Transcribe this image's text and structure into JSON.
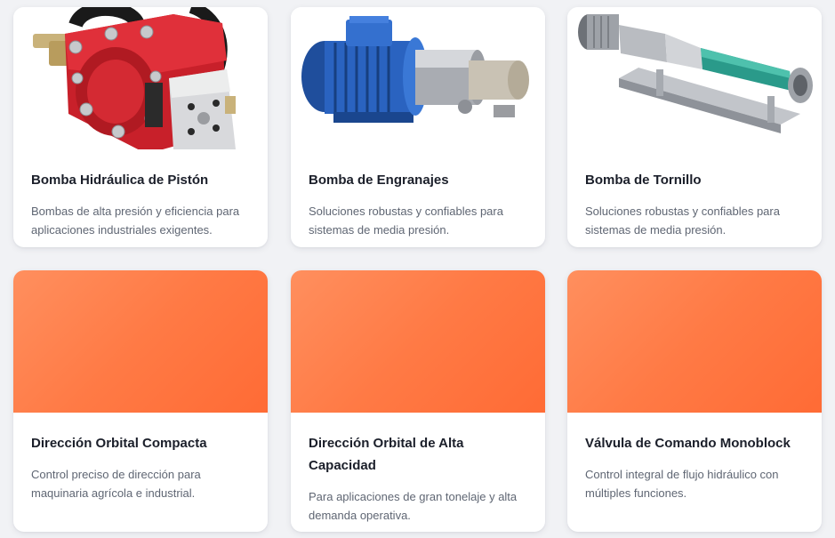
{
  "cards": [
    {
      "title": "Bomba Hidráulica de Pistón",
      "description": "Bombas de alta presión y eficiencia para aplicaciones industriales exigentes.",
      "image": "piston-pump-photo"
    },
    {
      "title": "Bomba de Engranajes",
      "description": "Soluciones robustas y confiables para sistemas de media presión.",
      "image": "gear-pump-photo"
    },
    {
      "title": "Bomba de Tornillo",
      "description": "Soluciones robustas y confiables para sistemas de media presión.",
      "image": "screw-pump-photo"
    },
    {
      "title": "Dirección Orbital Compacta",
      "description": "Control preciso de dirección para maquinaria agrícola e industrial.",
      "image": "orange-gradient-placeholder"
    },
    {
      "title": "Dirección Orbital de Alta Capacidad",
      "description": "Para aplicaciones de gran tonelaje y alta demanda operativa.",
      "image": "orange-gradient-placeholder"
    },
    {
      "title": "Válvula de Comando Monoblock",
      "description": "Control integral de flujo hidráulico con múltiples funciones.",
      "image": "orange-gradient-placeholder"
    }
  ],
  "colors": {
    "accent_orange_start": "#ff8f5e",
    "accent_orange_end": "#ff6b35",
    "title_text": "#1b1f2a",
    "body_text": "#5f6673",
    "page_background": "#f1f2f5"
  }
}
